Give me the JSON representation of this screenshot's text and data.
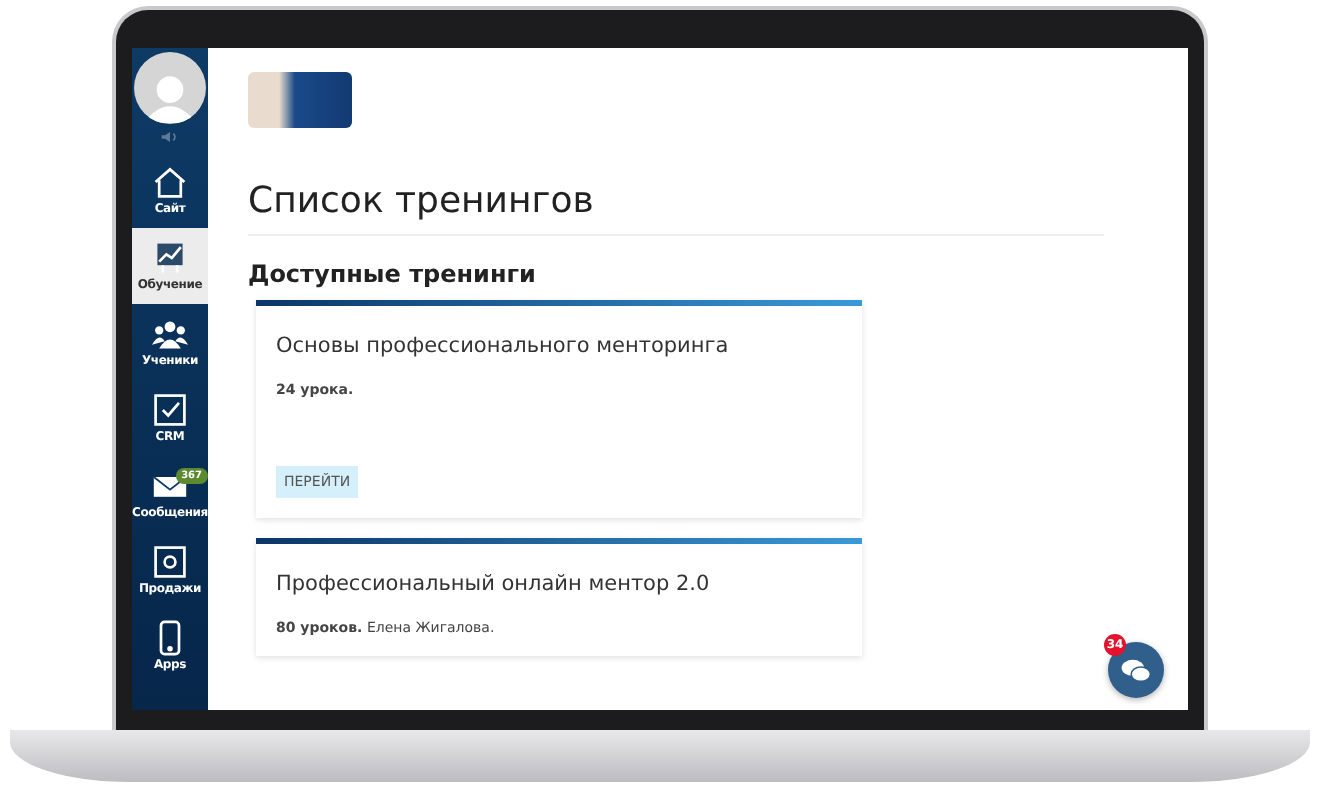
{
  "sidebar": {
    "items": [
      {
        "label": "Сайт",
        "selected": false
      },
      {
        "label": "Обучение",
        "selected": true
      },
      {
        "label": "Ученики",
        "selected": false
      },
      {
        "label": "CRM",
        "selected": false
      },
      {
        "label": "Сообщения",
        "selected": false,
        "badge": "367"
      },
      {
        "label": "Продажи",
        "selected": false
      },
      {
        "label": "Apps",
        "selected": false
      }
    ]
  },
  "page": {
    "title": "Список тренингов",
    "section_title": "Доступные тренинги",
    "trainings": [
      {
        "title": "Основы профессионального менторинга",
        "lessons": "24 урока.",
        "button": "ПЕРЕЙТИ"
      },
      {
        "title": "Профессиональный онлайн ментор 2.0",
        "lessons": "80 уроков.",
        "author": "Елена Жигалова."
      }
    ]
  },
  "chat": {
    "badge": "34"
  }
}
